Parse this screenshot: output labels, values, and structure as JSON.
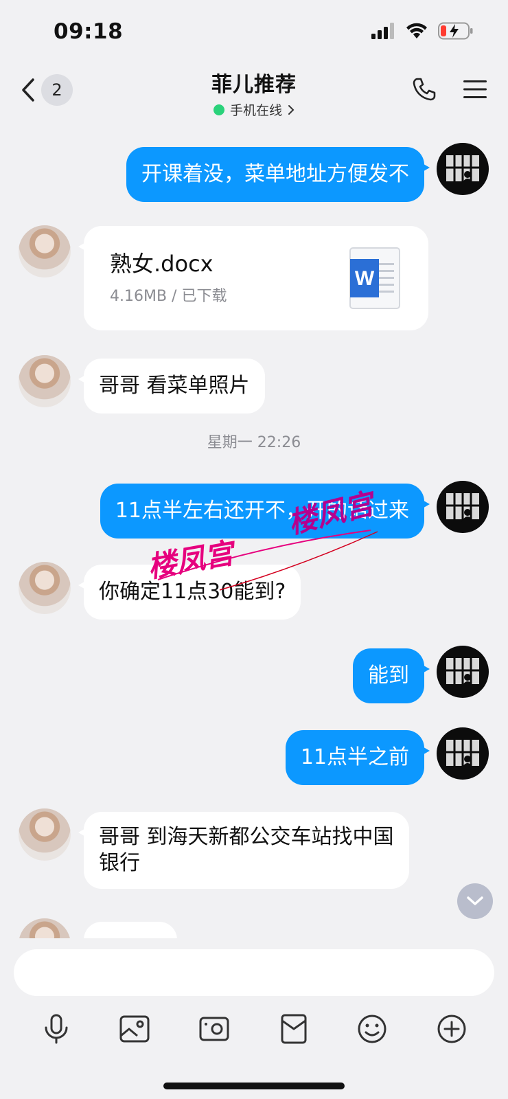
{
  "status_bar": {
    "time": "09:18"
  },
  "nav": {
    "back_count": "2",
    "title": "菲儿推荐",
    "subtitle": "手机在线"
  },
  "messages": {
    "m1": "开课着没，菜单地址方便发不",
    "file": {
      "name": "熟女.docx",
      "meta": "4.16MB / 已下载"
    },
    "m3": "哥哥  看菜单照片",
    "timestamp": "星期一 22:26",
    "m4": "11点半左右还开不，开的话过来",
    "m5": "你确定11点30能到?",
    "m6": "能到",
    "m7": "11点半之前",
    "m8_line1": "哥哥  到海天新都公交车站找中国",
    "m8_line2": "银行"
  },
  "watermarks": {
    "primary": "楼凤宫",
    "secondary": "楼凤宫"
  },
  "colors": {
    "outgoing_bubble": "#0c98ff",
    "incoming_bubble": "#ffffff",
    "background": "#f1f1f3",
    "online": "#2ad27a",
    "watermark": "#e6007e"
  },
  "composer": {
    "placeholder": ""
  },
  "icons": [
    "microphone-icon",
    "image-icon",
    "camera-icon",
    "red-packet-icon",
    "emoji-icon",
    "plus-icon"
  ]
}
